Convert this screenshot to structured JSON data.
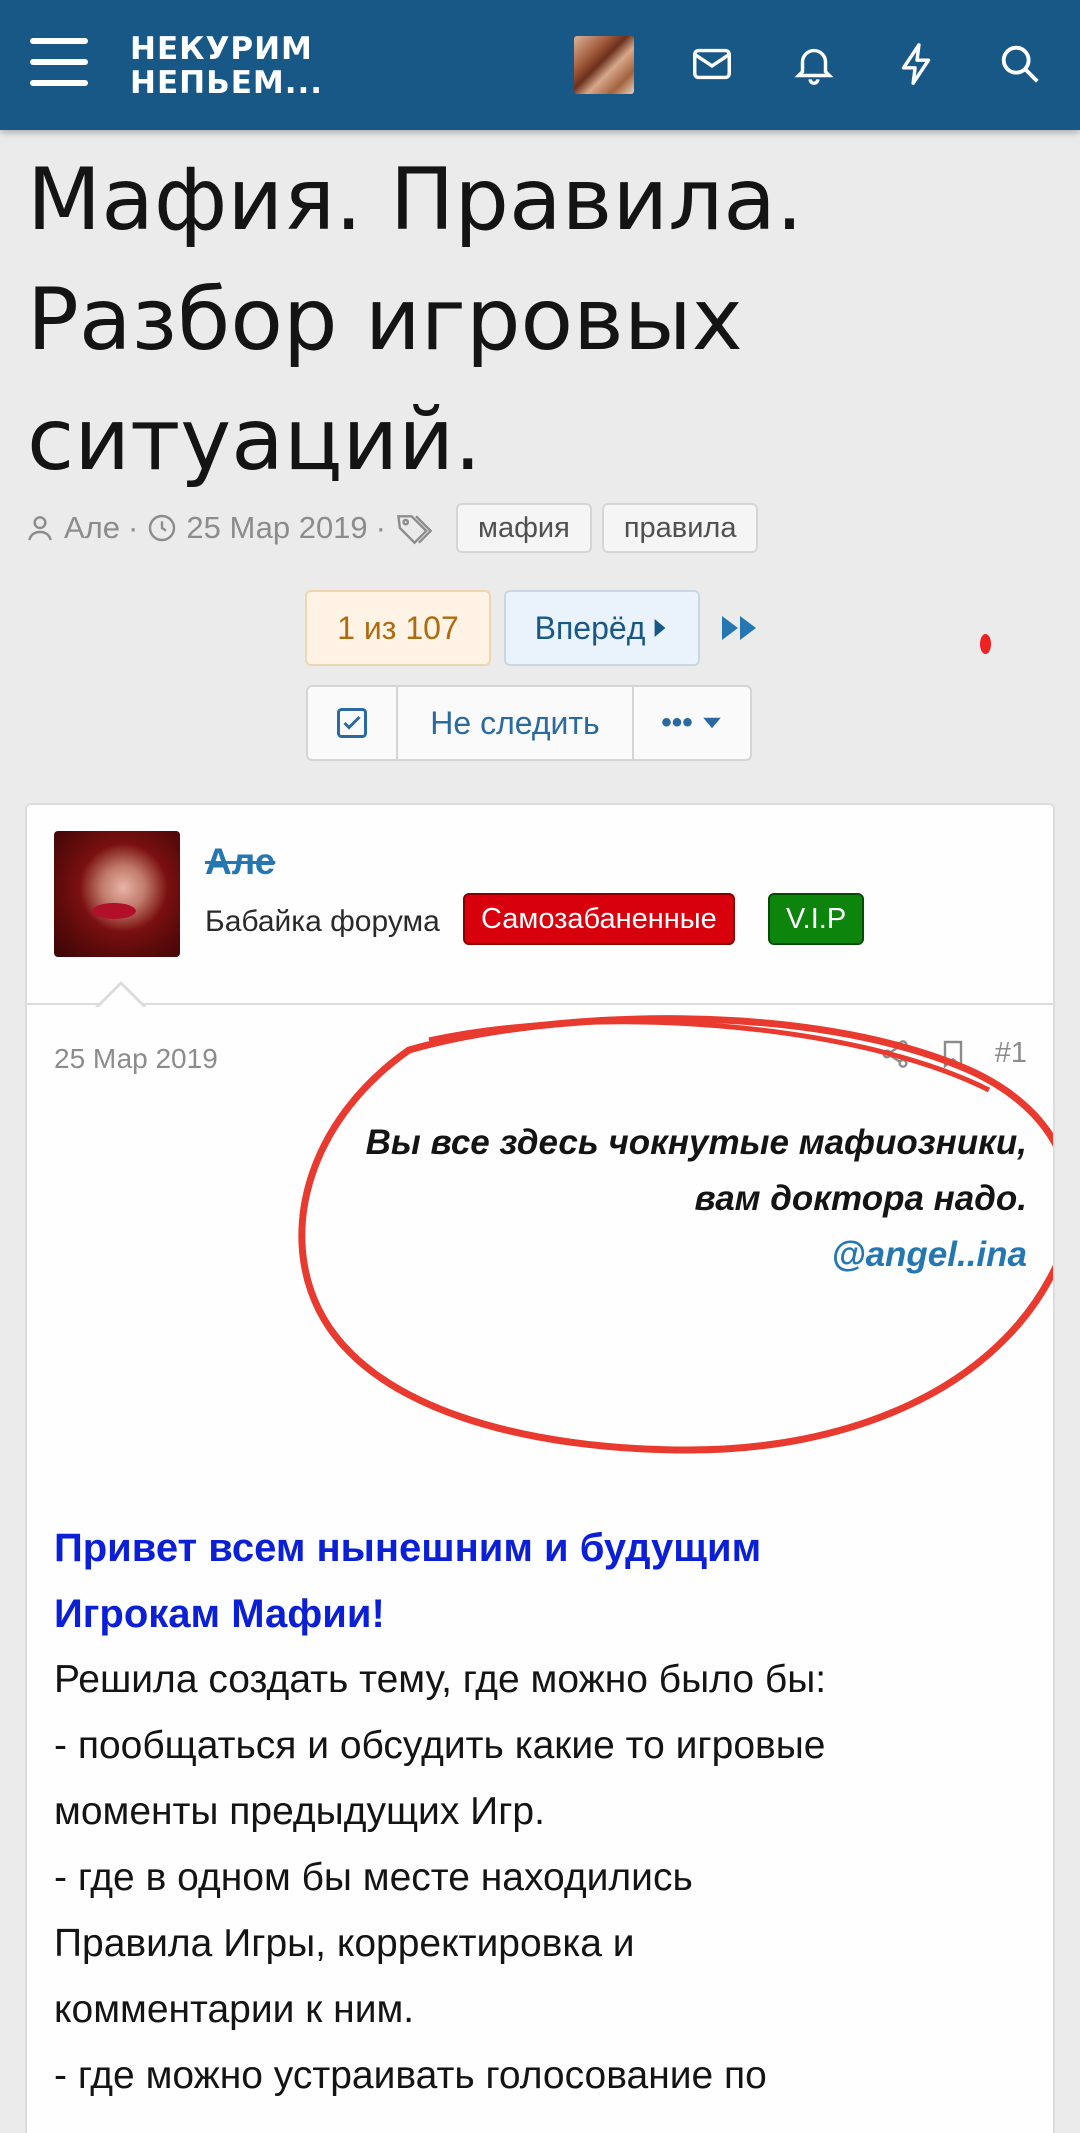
{
  "header": {
    "logo_line1": "НЕКУРИМ",
    "logo_line2": "НЕПЬЕМ...",
    "icons": [
      "menu-icon",
      "avatar",
      "mail-icon",
      "bell-icon",
      "lightning-icon",
      "search-icon"
    ],
    "bg_color": "#185886"
  },
  "thread": {
    "title": "Мафия. Правила. Разбор игровых ситуаций.",
    "author": "Але",
    "date": "25 Мар 2019",
    "tags": [
      "мафия",
      "правила"
    ]
  },
  "pagination": {
    "current": "1 из 107",
    "next": "Вперёд"
  },
  "watch": {
    "label": "Не следить",
    "more": "•••"
  },
  "post": {
    "username": "Але",
    "user_title": "Бабайка форума",
    "banners": [
      "Самозабаненные",
      "V.I.P"
    ],
    "date": "25 Мар 2019",
    "number": "#1",
    "quote_line1": "Вы все здесь чокнутые мафиозники,",
    "quote_line2": "вам доктора надо.",
    "quote_mention": "@angel..ina",
    "greeting_line1": "Привет всем нынешним и будущим",
    "greeting_line2": "Игрокам Мафии!",
    "body_lines": [
      "Решила создать тему, где можно было бы:",
      "- пообщаться и обсудить какие то игровые",
      "моменты предыдущих Игр.",
      "- где в одном бы месте находились",
      "Правила Игры, корректировка и",
      "комментарии к ним.",
      "- где можно устраивать голосование по"
    ]
  }
}
